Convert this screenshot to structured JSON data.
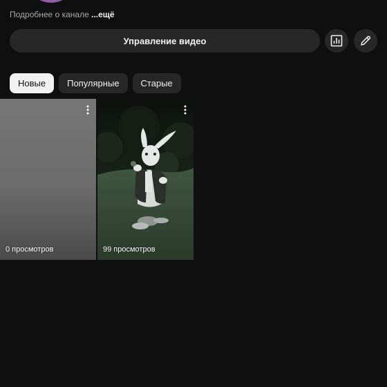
{
  "channel": {
    "about_text": "Подробнее о канале",
    "more_label": "...ещё"
  },
  "actions": {
    "manage_label": "Управление видео",
    "analytics_icon": "bar-chart-icon",
    "edit_icon": "pencil-icon"
  },
  "sort_chips": [
    {
      "label": "Новые",
      "active": true
    },
    {
      "label": "Популярные",
      "active": false
    },
    {
      "label": "Старые",
      "active": false
    }
  ],
  "shorts": [
    {
      "views": "0 просмотров",
      "thumbnail": "gray-gradient"
    },
    {
      "views": "99 просмотров",
      "thumbnail": "white-rabbit-scene"
    }
  ],
  "colors": {
    "background": "#0f0f0f",
    "surface": "#272727",
    "text": "#f1f1f1",
    "muted": "#aaaaaa",
    "chip_active_bg": "#f1f1f1"
  }
}
